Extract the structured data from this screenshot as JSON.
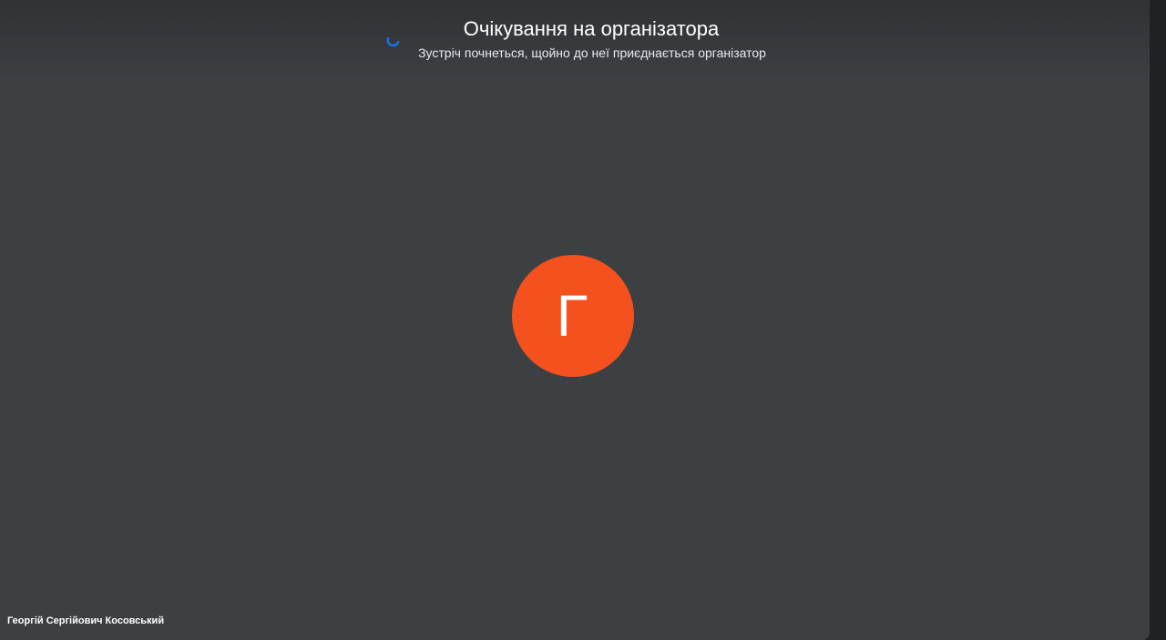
{
  "header": {
    "title": "Очікування на організатора",
    "subtitle": "Зустріч почнеться, щойно до неї приєднається організатор",
    "spinner_icon": "loading-spinner-icon",
    "spinner_color": "#1a73e8"
  },
  "participant": {
    "avatar_letter": "Г",
    "avatar_color": "#f4511e",
    "name": "Георгій Сергійович Косовський"
  },
  "colors": {
    "stage_background": "#3c4043",
    "page_background": "#202124"
  }
}
